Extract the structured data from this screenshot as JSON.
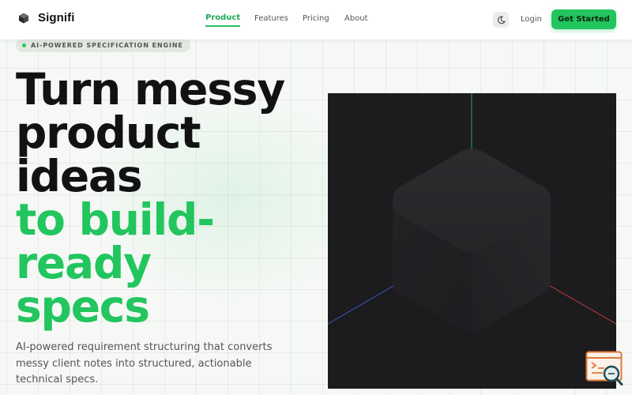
{
  "brand": {
    "name": "Signifi",
    "logo_icon": "cube-icon"
  },
  "nav": {
    "items": [
      {
        "label": "Product",
        "active": true
      },
      {
        "label": "Features",
        "active": false
      },
      {
        "label": "Pricing",
        "active": false
      },
      {
        "label": "About",
        "active": false
      }
    ]
  },
  "header_actions": {
    "theme_toggle_icon": "moon-icon",
    "login_label": "Login",
    "cta_label": "Get Started"
  },
  "hero": {
    "badge": "AI-POWERED SPECIFICATION ENGINE",
    "headline_dark": [
      "Turn messy",
      "product",
      "ideas"
    ],
    "headline_green": [
      "to build-",
      "ready",
      "specs"
    ],
    "subtitle": "AI-powered requirement structuring that converts messy client notes into structured, actionable technical specs."
  },
  "viewport": {
    "description_icon": "3d-cube-viewport",
    "axis_colors": {
      "x": "#d93b3b",
      "y": "#22c55e",
      "z": "#3b5bdb"
    }
  },
  "floating_widget": {
    "icon": "search-code-icon"
  },
  "colors": {
    "accent": "#22c55e",
    "text_dark": "#121212",
    "text_muted": "#555555",
    "canvas_bg": "#1c1c1e"
  }
}
